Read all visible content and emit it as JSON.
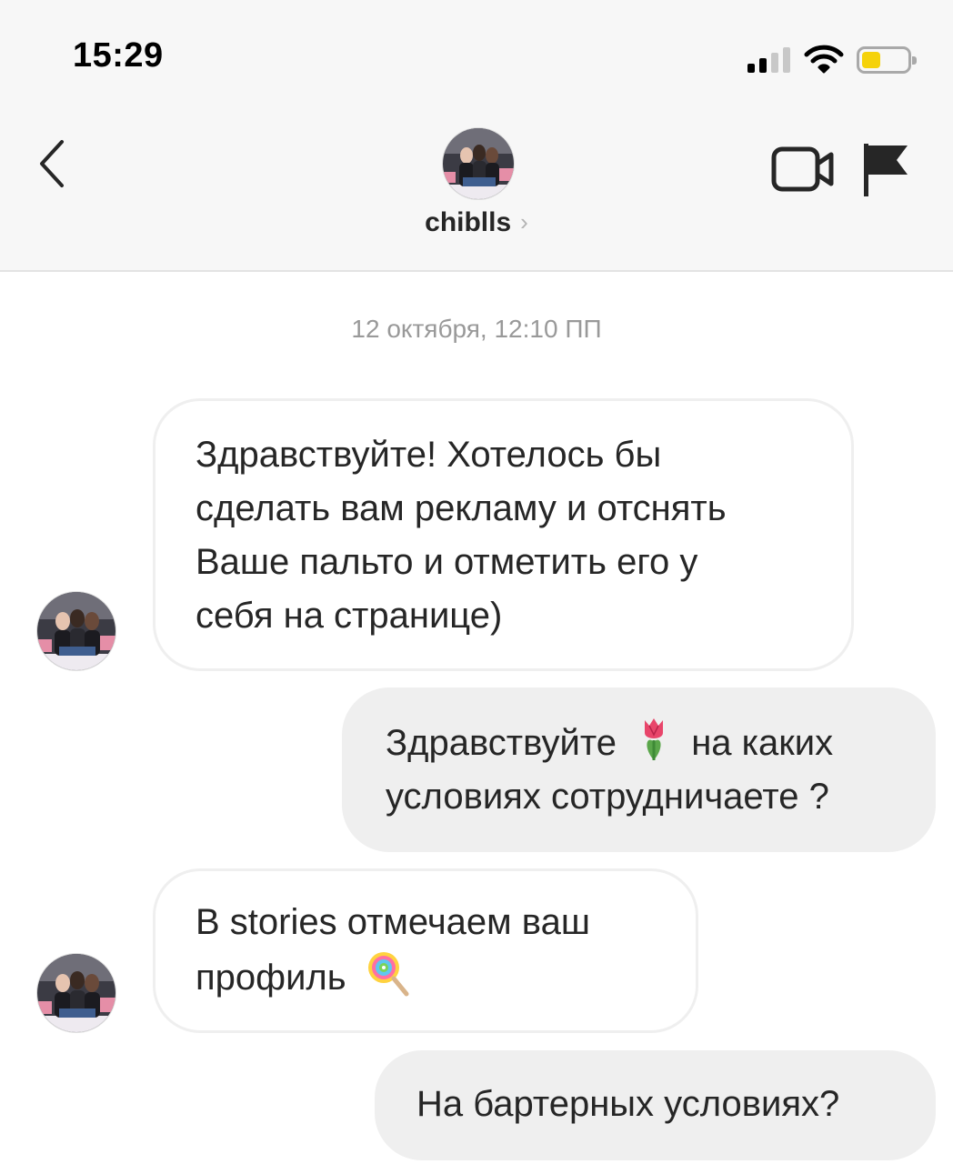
{
  "status_bar": {
    "time": "15:29",
    "signal_bars_filled": 2,
    "signal_bars_total": 4,
    "battery_level": 0.3,
    "battery_color": "#f5d20a"
  },
  "header": {
    "username": "chiblls",
    "username_chevron": "›",
    "icons": [
      "back-chevron-icon",
      "video-camera-icon",
      "flag-icon"
    ]
  },
  "conversation": {
    "date_separator": "12 октября, 12:10 ПП",
    "messages": [
      {
        "from": "them",
        "lines": [
          "Здравствуйте! Хотелось бы",
          "сделать вам рекламу и отснять",
          "Ваше пальто и отметить его у",
          "себя на странице)"
        ]
      },
      {
        "from": "me",
        "line1_before_emoji": "Здравствуйте",
        "line1_emoji": "tulip-emoji",
        "line1_after_emoji": "на каких",
        "line2": "условиях сотрудничаете ?"
      },
      {
        "from": "them",
        "line1": "В stories отмечаем ваш",
        "line2": "профиль",
        "line2_emoji": "lollipop-emoji"
      },
      {
        "from": "me",
        "line1": "На бартерных условиях?"
      }
    ]
  },
  "colors": {
    "header_bg": "#f7f7f7",
    "outgoing_bubble": "#efefef",
    "incoming_border": "#efefef",
    "meta_text": "#999999"
  }
}
